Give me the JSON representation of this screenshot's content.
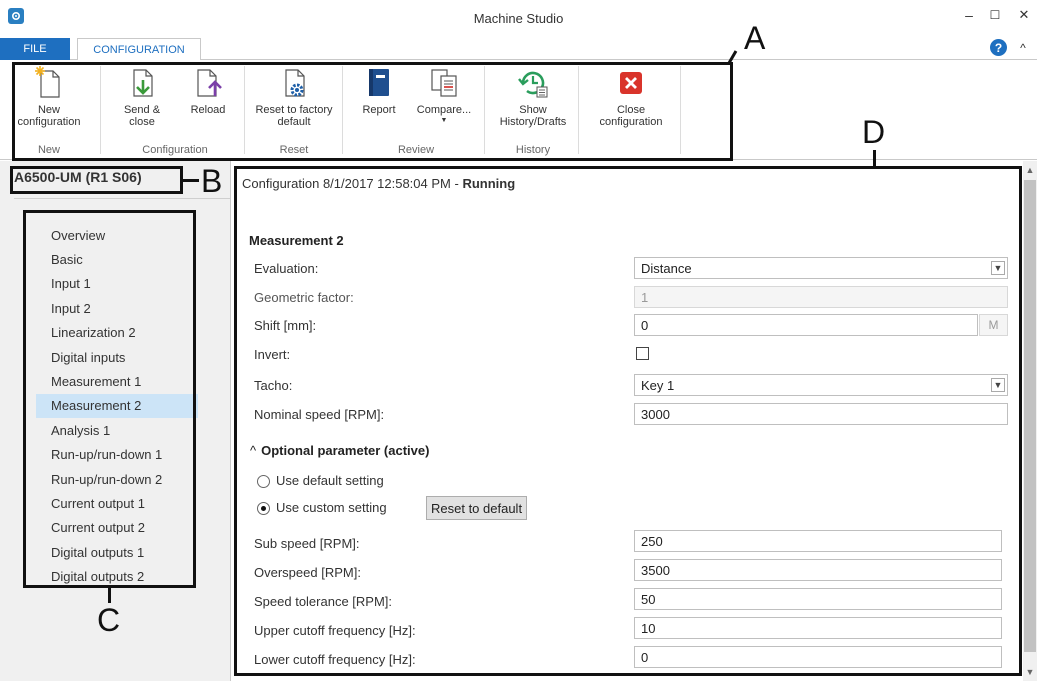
{
  "window": {
    "title": "Machine Studio",
    "minimize": "–",
    "maximize": "☐",
    "close": "✕"
  },
  "tabs": {
    "file": "FILE",
    "configuration": "CONFIGURATION",
    "help": "?",
    "collapse": "^"
  },
  "ribbon": {
    "buttons": {
      "new_config": "New configuration",
      "send_close": "Send & close",
      "reload": "Reload",
      "reset_factory": "Reset to factory default",
      "report": "Report",
      "compare": "Compare...",
      "show_history": "Show History/Drafts",
      "close_config": "Close configuration"
    },
    "groups": {
      "new": "New",
      "configuration": "Configuration",
      "reset": "Reset",
      "review": "Review",
      "history": "History"
    }
  },
  "annotations": {
    "a": "A",
    "b": "B",
    "c": "C",
    "d": "D"
  },
  "device": "A6500-UM (R1 S06)",
  "nav": [
    "Overview",
    "Basic",
    "Input 1",
    "Input 2",
    "Linearization 2",
    "Digital inputs",
    "Measurement 1",
    "Measurement 2",
    "Analysis 1",
    "Run-up/run-down 1",
    "Run-up/run-down 2",
    "Current output 1",
    "Current output 2",
    "Digital outputs 1",
    "Digital outputs 2"
  ],
  "nav_active_index": 7,
  "config": {
    "header_prefix": "Configuration 8/1/2017 12:58:04 PM - ",
    "header_status": "Running",
    "section_title": "Measurement 2",
    "fields": {
      "evaluation_label": "Evaluation:",
      "evaluation_value": "Distance",
      "geometric_label": "Geometric factor:",
      "geometric_value": "1",
      "shift_label": "Shift [mm]:",
      "shift_value": "0",
      "shift_btn": "M",
      "invert_label": "Invert:",
      "tacho_label": "Tacho:",
      "tacho_value": "Key 1",
      "nominal_label": "Nominal speed [RPM]:",
      "nominal_value": "3000"
    },
    "optional": {
      "title": "Optional parameter (active)",
      "use_default": "Use default setting",
      "use_custom": "Use custom setting",
      "reset_btn": "Reset to default",
      "sub_label": "Sub speed [RPM]:",
      "sub_value": "250",
      "over_label": "Overspeed [RPM]:",
      "over_value": "3500",
      "tol_label": "Speed tolerance [RPM]:",
      "tol_value": "50",
      "upper_label": "Upper cutoff frequency [Hz]:",
      "upper_value": "10",
      "lower_label": "Lower cutoff frequency [Hz]:",
      "lower_value": "0"
    }
  }
}
